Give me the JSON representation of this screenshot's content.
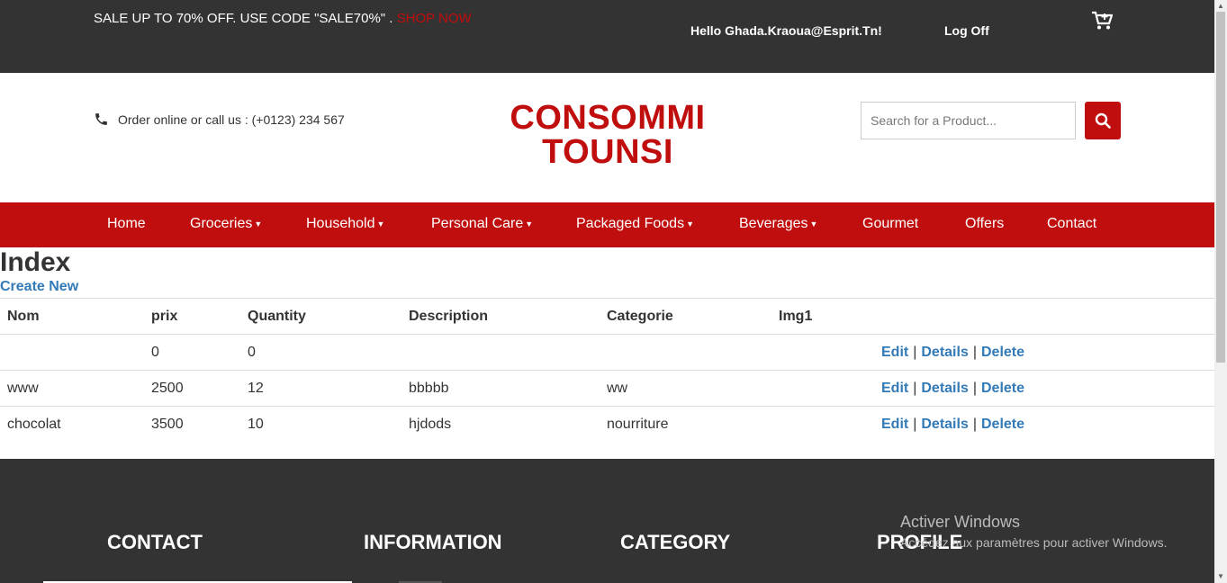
{
  "topbar": {
    "promo_text": "SALE UP TO 70% OFF. USE CODE \"SALE70%\" .",
    "shop_now": "SHOP NOW",
    "hello": "Hello Ghada.Kraoua@Esprit.Tn!",
    "logoff": "Log Off",
    "cart_icon": "cart-icon"
  },
  "header": {
    "phone_text": "Order online or call us : (+0123) 234 567",
    "brand_line1": "CONSOMMI",
    "brand_line2": "TOUNSI",
    "search_placeholder": "Search for a Product..."
  },
  "nav": {
    "items": [
      "Home",
      "Groceries",
      "Household",
      "Personal Care",
      "Packaged Foods",
      "Beverages",
      "Gourmet",
      "Offers",
      "Contact"
    ]
  },
  "page": {
    "title": "Index",
    "create_new": "Create New"
  },
  "table": {
    "headers": [
      "Nom",
      "prix",
      "Quantity",
      "Description",
      "Categorie",
      "Img1"
    ],
    "rows": [
      [
        "",
        "0",
        "0",
        "",
        "",
        ""
      ],
      [
        "www",
        "2500",
        "12",
        "bbbbb",
        "ww",
        ""
      ],
      [
        "chocolat",
        "3500",
        "10",
        "hjdods",
        "nourriture",
        ""
      ]
    ],
    "actions": {
      "edit": "Edit",
      "details": "Details",
      "delete": "Delete",
      "sep": "|"
    }
  },
  "footer": {
    "headings": [
      "CONTACT",
      "INFORMATION",
      "CATEGORY",
      "PROFILE"
    ]
  },
  "watermark": {
    "line1": "Activer Windows",
    "line2": "Accédez aux paramètres pour activer Windows."
  },
  "colors": {
    "brand_red": "#c00d0d",
    "dark": "#333333",
    "link": "#337ab7"
  }
}
